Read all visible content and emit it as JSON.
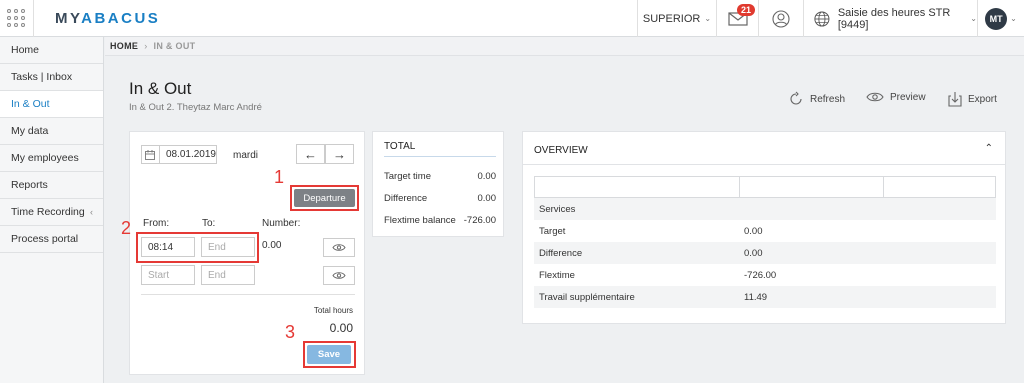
{
  "header": {
    "logo_my": "MY",
    "logo_abacus": "ABACUS",
    "superior_label": "SUPERIOR",
    "mail_badge": "21",
    "company": "Saisie des heures STR [9449]",
    "avatar_initials": "MT"
  },
  "sidebar": {
    "items": [
      {
        "label": "Home"
      },
      {
        "label": "Tasks | Inbox"
      },
      {
        "label": "In & Out"
      },
      {
        "label": "My data"
      },
      {
        "label": "My employees"
      },
      {
        "label": "Reports"
      },
      {
        "label": "Time Recording"
      },
      {
        "label": "Process portal"
      }
    ]
  },
  "breadcrumb": {
    "home": "HOME",
    "current": "IN & OUT"
  },
  "page": {
    "title": "In & Out",
    "subtitle": "In & Out 2. Theytaz Marc André"
  },
  "actions": {
    "refresh": "Refresh",
    "preview": "Preview",
    "export": "Export"
  },
  "entry": {
    "date": "08.01.2019",
    "weekday": "mardi",
    "departure_label": "Departure",
    "from_label": "From:",
    "to_label": "To:",
    "number_label": "Number:",
    "row1_from": "08:14",
    "row1_to_placeholder": "End",
    "row1_number": "0.00",
    "row2_from_placeholder": "Start",
    "row2_to_placeholder": "End",
    "total_hours_label": "Total hours",
    "total_hours_value": "0.00",
    "save_label": "Save",
    "annotations": [
      "1",
      "2",
      "3"
    ]
  },
  "total": {
    "heading": "TOTAL",
    "rows": [
      {
        "label": "Target time",
        "value": "0.00"
      },
      {
        "label": "Difference",
        "value": "0.00"
      },
      {
        "label": "Flextime balance",
        "value": "-726.00"
      }
    ]
  },
  "overview": {
    "heading": "OVERVIEW",
    "rows": [
      {
        "label": "Services",
        "value": ""
      },
      {
        "label": "Target",
        "value": "0.00"
      },
      {
        "label": "Difference",
        "value": "0.00"
      },
      {
        "label": "Flextime",
        "value": "-726.00"
      },
      {
        "label": "Travail supplémentaire",
        "value": "11.49"
      }
    ]
  },
  "colors": {
    "accent": "#1a7fc4",
    "annotation": "#e53935",
    "save": "#86b8e1",
    "departure": "#7d8186"
  }
}
